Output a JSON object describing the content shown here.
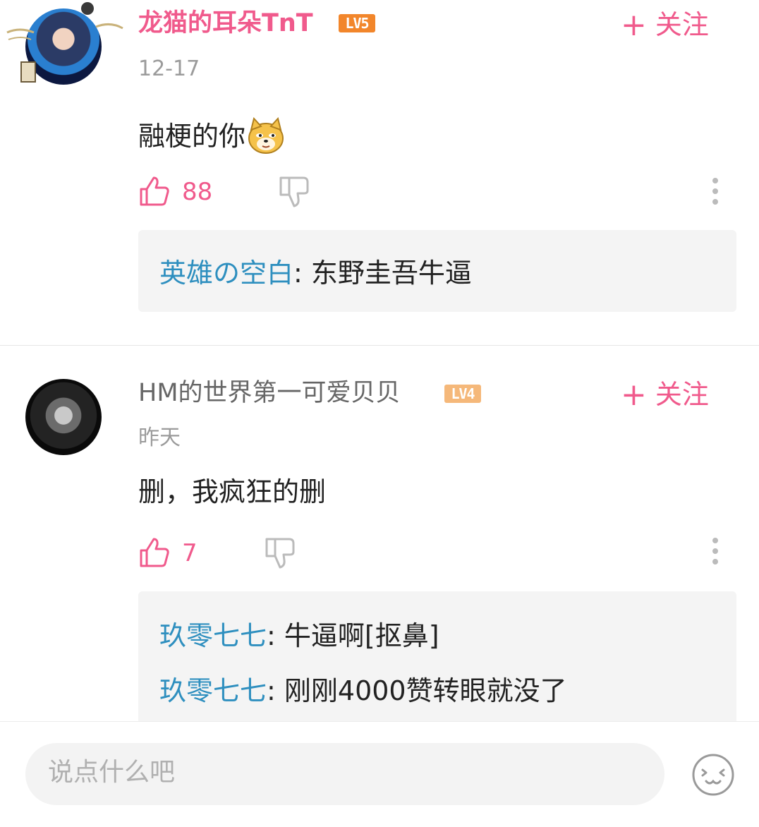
{
  "comments": [
    {
      "username": "龙猫的耳朵TnT",
      "level": "LV5",
      "follow_label": "关注",
      "date": "12-17",
      "text": "融梗的你",
      "likes": "88",
      "replies": [
        {
          "name": "英雄の空白",
          "text": ": 东野圭吾牛逼"
        }
      ]
    },
    {
      "username": "HM的世界第一可爱贝贝",
      "level": "LV4",
      "follow_label": "关注",
      "date": "昨天",
      "text": "删，我疯狂的删",
      "likes": "7",
      "replies": [
        {
          "name": "玖零七七",
          "text": ": 牛逼啊[抠鼻]"
        },
        {
          "name": "玖零七七",
          "text": ": 刚刚4000赞转眼就没了"
        }
      ]
    }
  ],
  "input": {
    "placeholder": "说点什么吧"
  },
  "icons": {
    "like": "thumbs-up-icon",
    "dislike": "thumbs-down-icon",
    "more": "more-vertical-icon",
    "emoji": "emoji-face-icon",
    "follow": "plus-icon"
  },
  "colors": {
    "accent": "#f05a8c",
    "reply_name": "#2e8fbf",
    "lv5": "#f2862b",
    "lv4": "#f5b87a"
  }
}
